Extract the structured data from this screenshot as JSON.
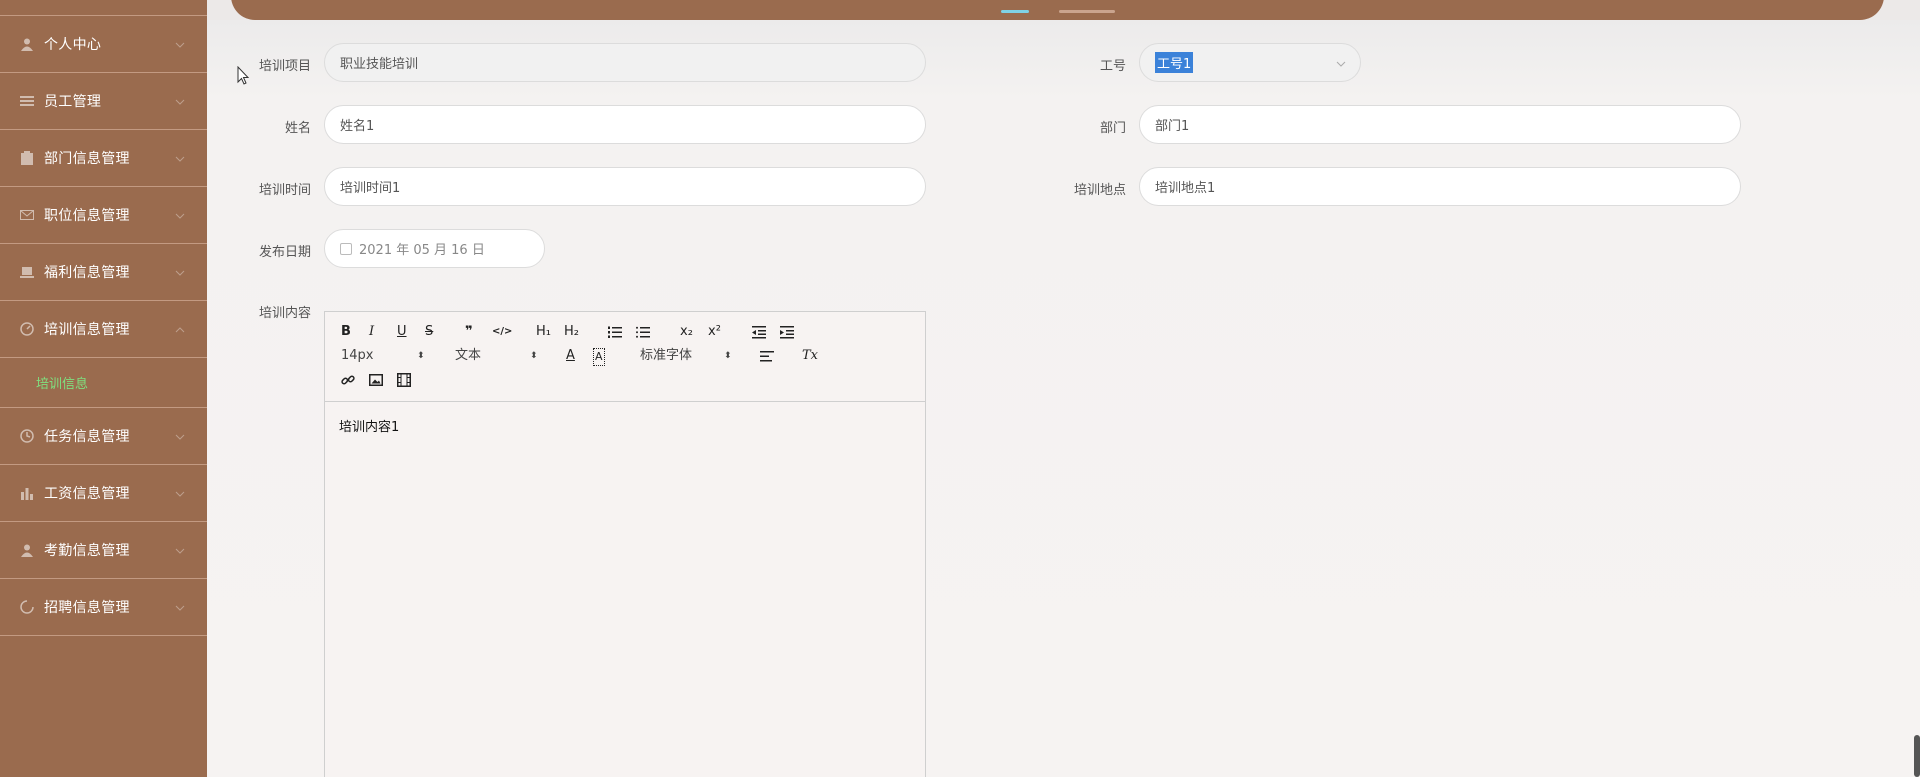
{
  "sidebar": {
    "items": [
      {
        "label": "个人中心",
        "icon": "person-icon"
      },
      {
        "label": "员工管理",
        "icon": "list-icon"
      },
      {
        "label": "部门信息管理",
        "icon": "clipboard-icon"
      },
      {
        "label": "职位信息管理",
        "icon": "mail-icon"
      },
      {
        "label": "福利信息管理",
        "icon": "laptop-icon"
      },
      {
        "label": "培训信息管理",
        "icon": "gauge-icon"
      },
      {
        "label": "任务信息管理",
        "icon": "clock-icon"
      },
      {
        "label": "工资信息管理",
        "icon": "bar-chart-icon"
      },
      {
        "label": "考勤信息管理",
        "icon": "person-icon"
      },
      {
        "label": "招聘信息管理",
        "icon": "spinner-icon"
      }
    ],
    "active_sub": "培训信息"
  },
  "form": {
    "project_label": "培训项目",
    "project_value": "职业技能培训",
    "job_no_label": "工号",
    "job_no_value": "工号1",
    "name_label": "姓名",
    "name_value": "姓名1",
    "dept_label": "部门",
    "dept_value": "部门1",
    "time_label": "培训时间",
    "time_value": "培训时间1",
    "place_label": "培训地点",
    "place_value": "培训地点1",
    "date_label": "发布日期",
    "date_value": "2021 年 05 月 16 日",
    "content_label": "培训内容",
    "content_value": "培训内容1"
  },
  "editor": {
    "font_size": "14px",
    "paragraph": "文本",
    "font_family": "标准字体",
    "buttons": {
      "bold": "B",
      "italic": "I",
      "underline": "U",
      "strike": "S",
      "quote": "❞",
      "code": "</>",
      "h1": "H₁",
      "h2": "H₂",
      "sub": "x₂",
      "sup": "x²",
      "color": "A",
      "bg": "A",
      "clear": "Tx"
    }
  },
  "colors": {
    "sidebar_bg": "#9a6b4e",
    "active_sub": "#7fe07f",
    "selection": "#3b82d9"
  }
}
